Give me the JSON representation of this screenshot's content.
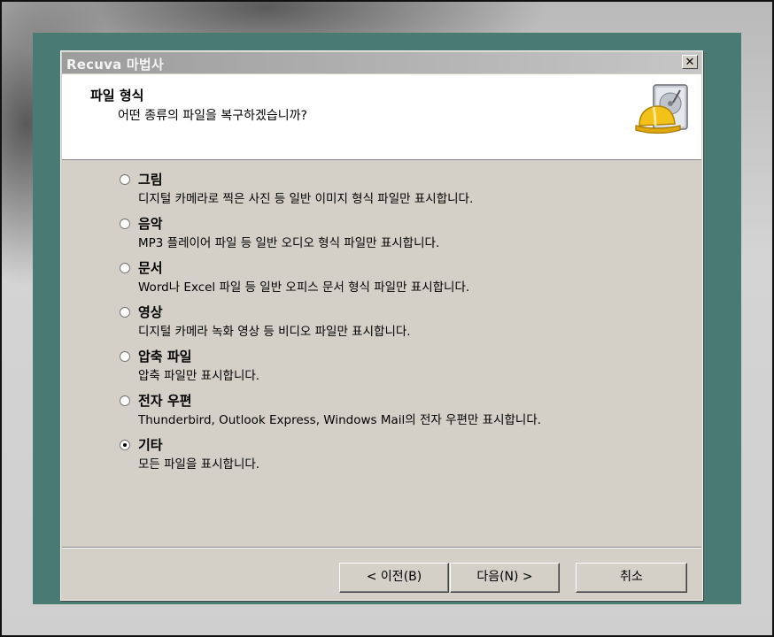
{
  "window": {
    "title": "Recuva 마법사",
    "close_glyph": "✕"
  },
  "header": {
    "title": "파일 형식",
    "subtitle": "어떤 종류의 파일을 복구하겠습니까?",
    "icon": "harddrive-hardhat-icon"
  },
  "options": [
    {
      "label": "그림",
      "desc": "디지털 카메라로 찍은 사진 등 일반 이미지 형식 파일만 표시합니다.",
      "checked": false
    },
    {
      "label": "음악",
      "desc": "MP3 플레이어 파일 등 일반 오디오 형식 파일만 표시합니다.",
      "checked": false
    },
    {
      "label": "문서",
      "desc": "Word나 Excel 파일 등 일반 오피스 문서 형식 파일만 표시합니다.",
      "checked": false
    },
    {
      "label": "영상",
      "desc": "디지털 카메라 녹화 영상 등 비디오 파일만 표시합니다.",
      "checked": false
    },
    {
      "label": "압축 파일",
      "desc": "압축 파일만 표시합니다.",
      "checked": false
    },
    {
      "label": "전자 우편",
      "desc": "Thunderbird, Outlook Express, Windows Mail의 전자 우편만 표시합니다.",
      "checked": false
    },
    {
      "label": "기타",
      "desc": "모든 파일을 표시합니다.",
      "checked": true
    }
  ],
  "buttons": {
    "back": "< 이전(B)",
    "next": "다음(N) >",
    "cancel": "취소"
  },
  "colors": {
    "dialog_face": "#d4d0c8",
    "backdrop_teal": "#4a7a74",
    "titlebar_inactive": "#9c9c9c"
  }
}
